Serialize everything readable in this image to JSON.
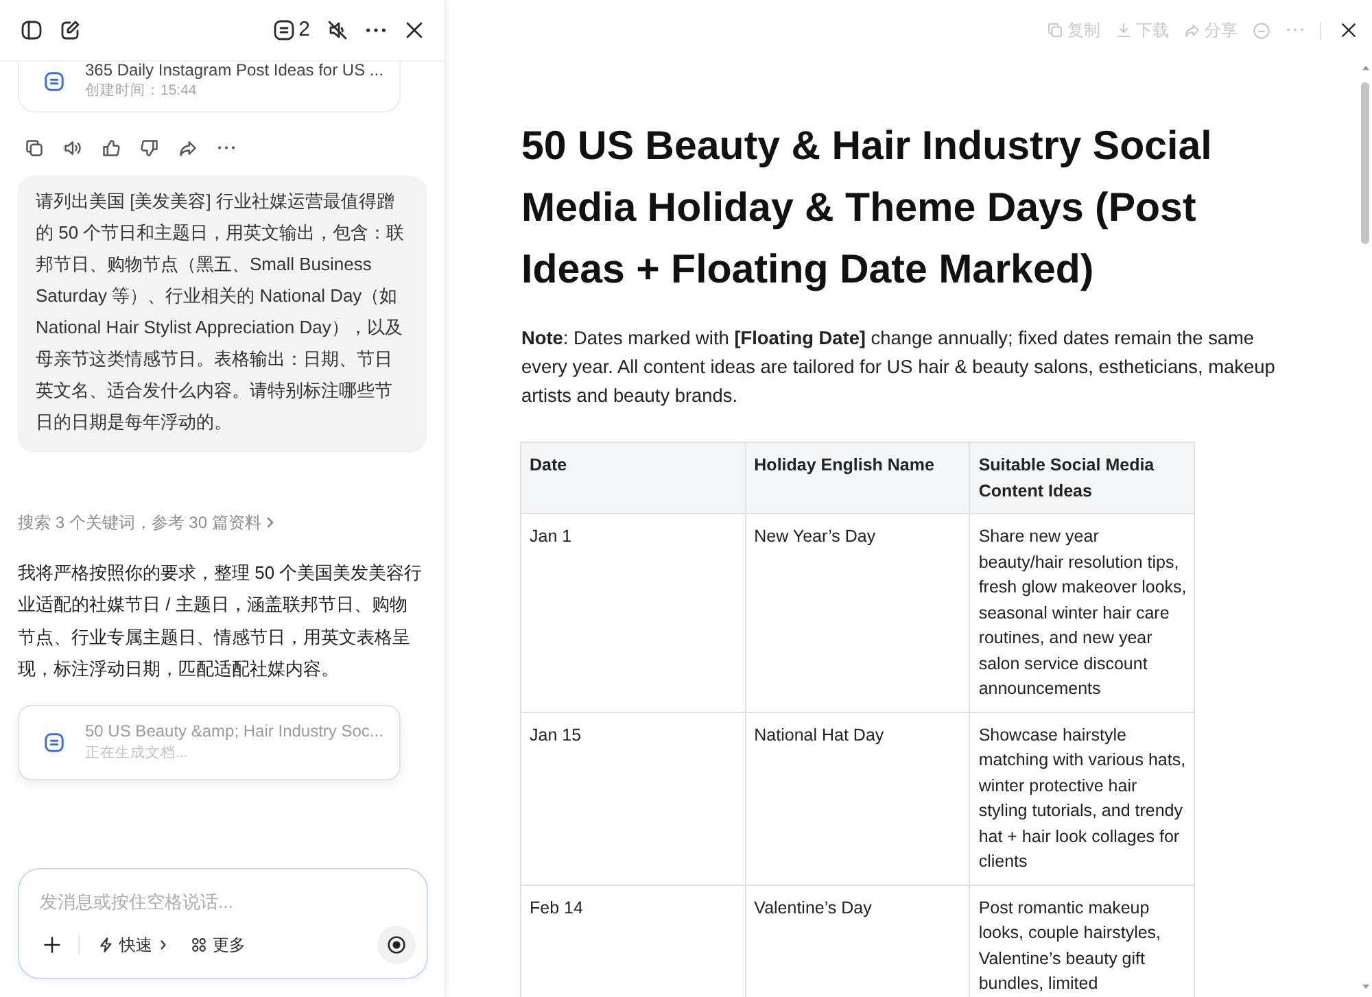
{
  "sidebar": {
    "header": {
      "doc_count": "2"
    },
    "previous_doc": {
      "title": "365 Daily Instagram Post Ideas for US ...",
      "subtitle": "创建时间：15:44"
    },
    "user_message": "请列出美国 [美发美容] 行业社媒运营最值得蹭的 50 个节日和主题日，用英文输出，包含：联邦节日、购物节点（黑五、Small Business Saturday 等）、行业相关的 National Day（如 National Hair Stylist Appreciation Day），以及母亲节这类情感节日。表格输出：日期、节日英文名、适合发什么内容。请特别标注哪些节日的日期是每年浮动的。",
    "search_summary": "搜索 3 个关键词，参考 30 篇资料",
    "assistant_message": "我将严格按照你的要求，整理 50 个美国美发美容行业适配的社媒节日 / 主题日，涵盖联邦节日、购物节点、行业专属主题日、情感节日，用英文表格呈现，标注浮动日期，匹配适配社媒内容。",
    "generating_doc": {
      "title": "50 US Beauty &amp; Hair Industry Soc...",
      "status": "正在生成文档..."
    },
    "composer": {
      "placeholder": "发消息或按住空格说话...",
      "tools": [
        {
          "kind": "speed",
          "label": "快速"
        },
        {
          "kind": "more",
          "label": "更多"
        }
      ]
    }
  },
  "document": {
    "toolbar": [
      {
        "kind": "copy",
        "label": "复制",
        "disabled": true
      },
      {
        "kind": "download",
        "label": "下载",
        "disabled": true
      },
      {
        "kind": "share",
        "label": "分享",
        "disabled": true
      },
      {
        "kind": "minus",
        "disabled": true
      },
      {
        "kind": "more",
        "disabled": true
      }
    ],
    "title": "50 US Beauty & Hair Industry Social Media Holiday & Theme Days (Post Ideas + Floating Date Marked)",
    "note": "**Note**: Dates marked with **[Floating Date]** change annually; fixed dates remain the same every year. All content ideas are tailored for US hair & beauty salons, estheticians, makeup artists and beauty brands.",
    "table": {
      "columns": [
        "Date",
        "Holiday English Name",
        "Suitable Social Media Content Ideas"
      ],
      "rows": [
        {
          "date": "Jan 1",
          "holiday": "New Year’s Day",
          "ideas": "Share new year beauty/hair resolution tips, fresh glow makeover looks, seasonal winter hair care routines, and new year salon service discount announcements"
        },
        {
          "date": "Jan 15",
          "holiday": "National Hat Day",
          "ideas": "Showcase hairstyle matching with various hats, winter protective hair styling tutorials, and trendy hat + hair look collages for clients"
        },
        {
          "date": "Feb 14",
          "holiday": "Valentine’s Day",
          "ideas": "Post romantic makeup looks, couple hairstyles, Valentine’s beauty gift bundles, limited"
        }
      ]
    }
  }
}
